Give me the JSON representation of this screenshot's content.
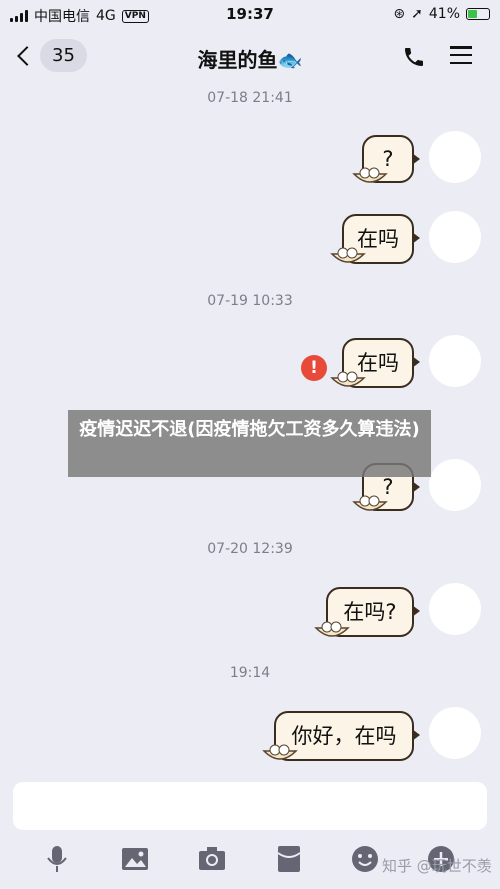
{
  "status_bar": {
    "carrier": "中国电信",
    "network": "4G",
    "vpn": "VPN",
    "time": "19:37",
    "battery": "41%"
  },
  "header": {
    "unread_count": "35",
    "title": "海里的鱼🐟"
  },
  "messages": {
    "ts1": "07-18 21:41",
    "m1": "?",
    "m2": "在吗",
    "ts2": "07-19 10:33",
    "m3": "在吗",
    "m3_error": "!",
    "m4": "?",
    "ts3": "07-20 12:39",
    "m5": "在吗?",
    "ts4": "19:14",
    "m6": "你好，在吗"
  },
  "overlay": {
    "text": "疫情迟迟不退(因疫情拖欠工资多久算违法)"
  },
  "toolbar": {
    "icons": [
      "microphone-icon",
      "image-icon",
      "camera-icon",
      "red-packet-icon",
      "emoji-icon",
      "plus-icon"
    ]
  },
  "watermark": "知乎 @玩世不羡",
  "colors": {
    "background": "#ececf4",
    "bubble": "#fcf5e7",
    "error": "#e84a3a"
  }
}
